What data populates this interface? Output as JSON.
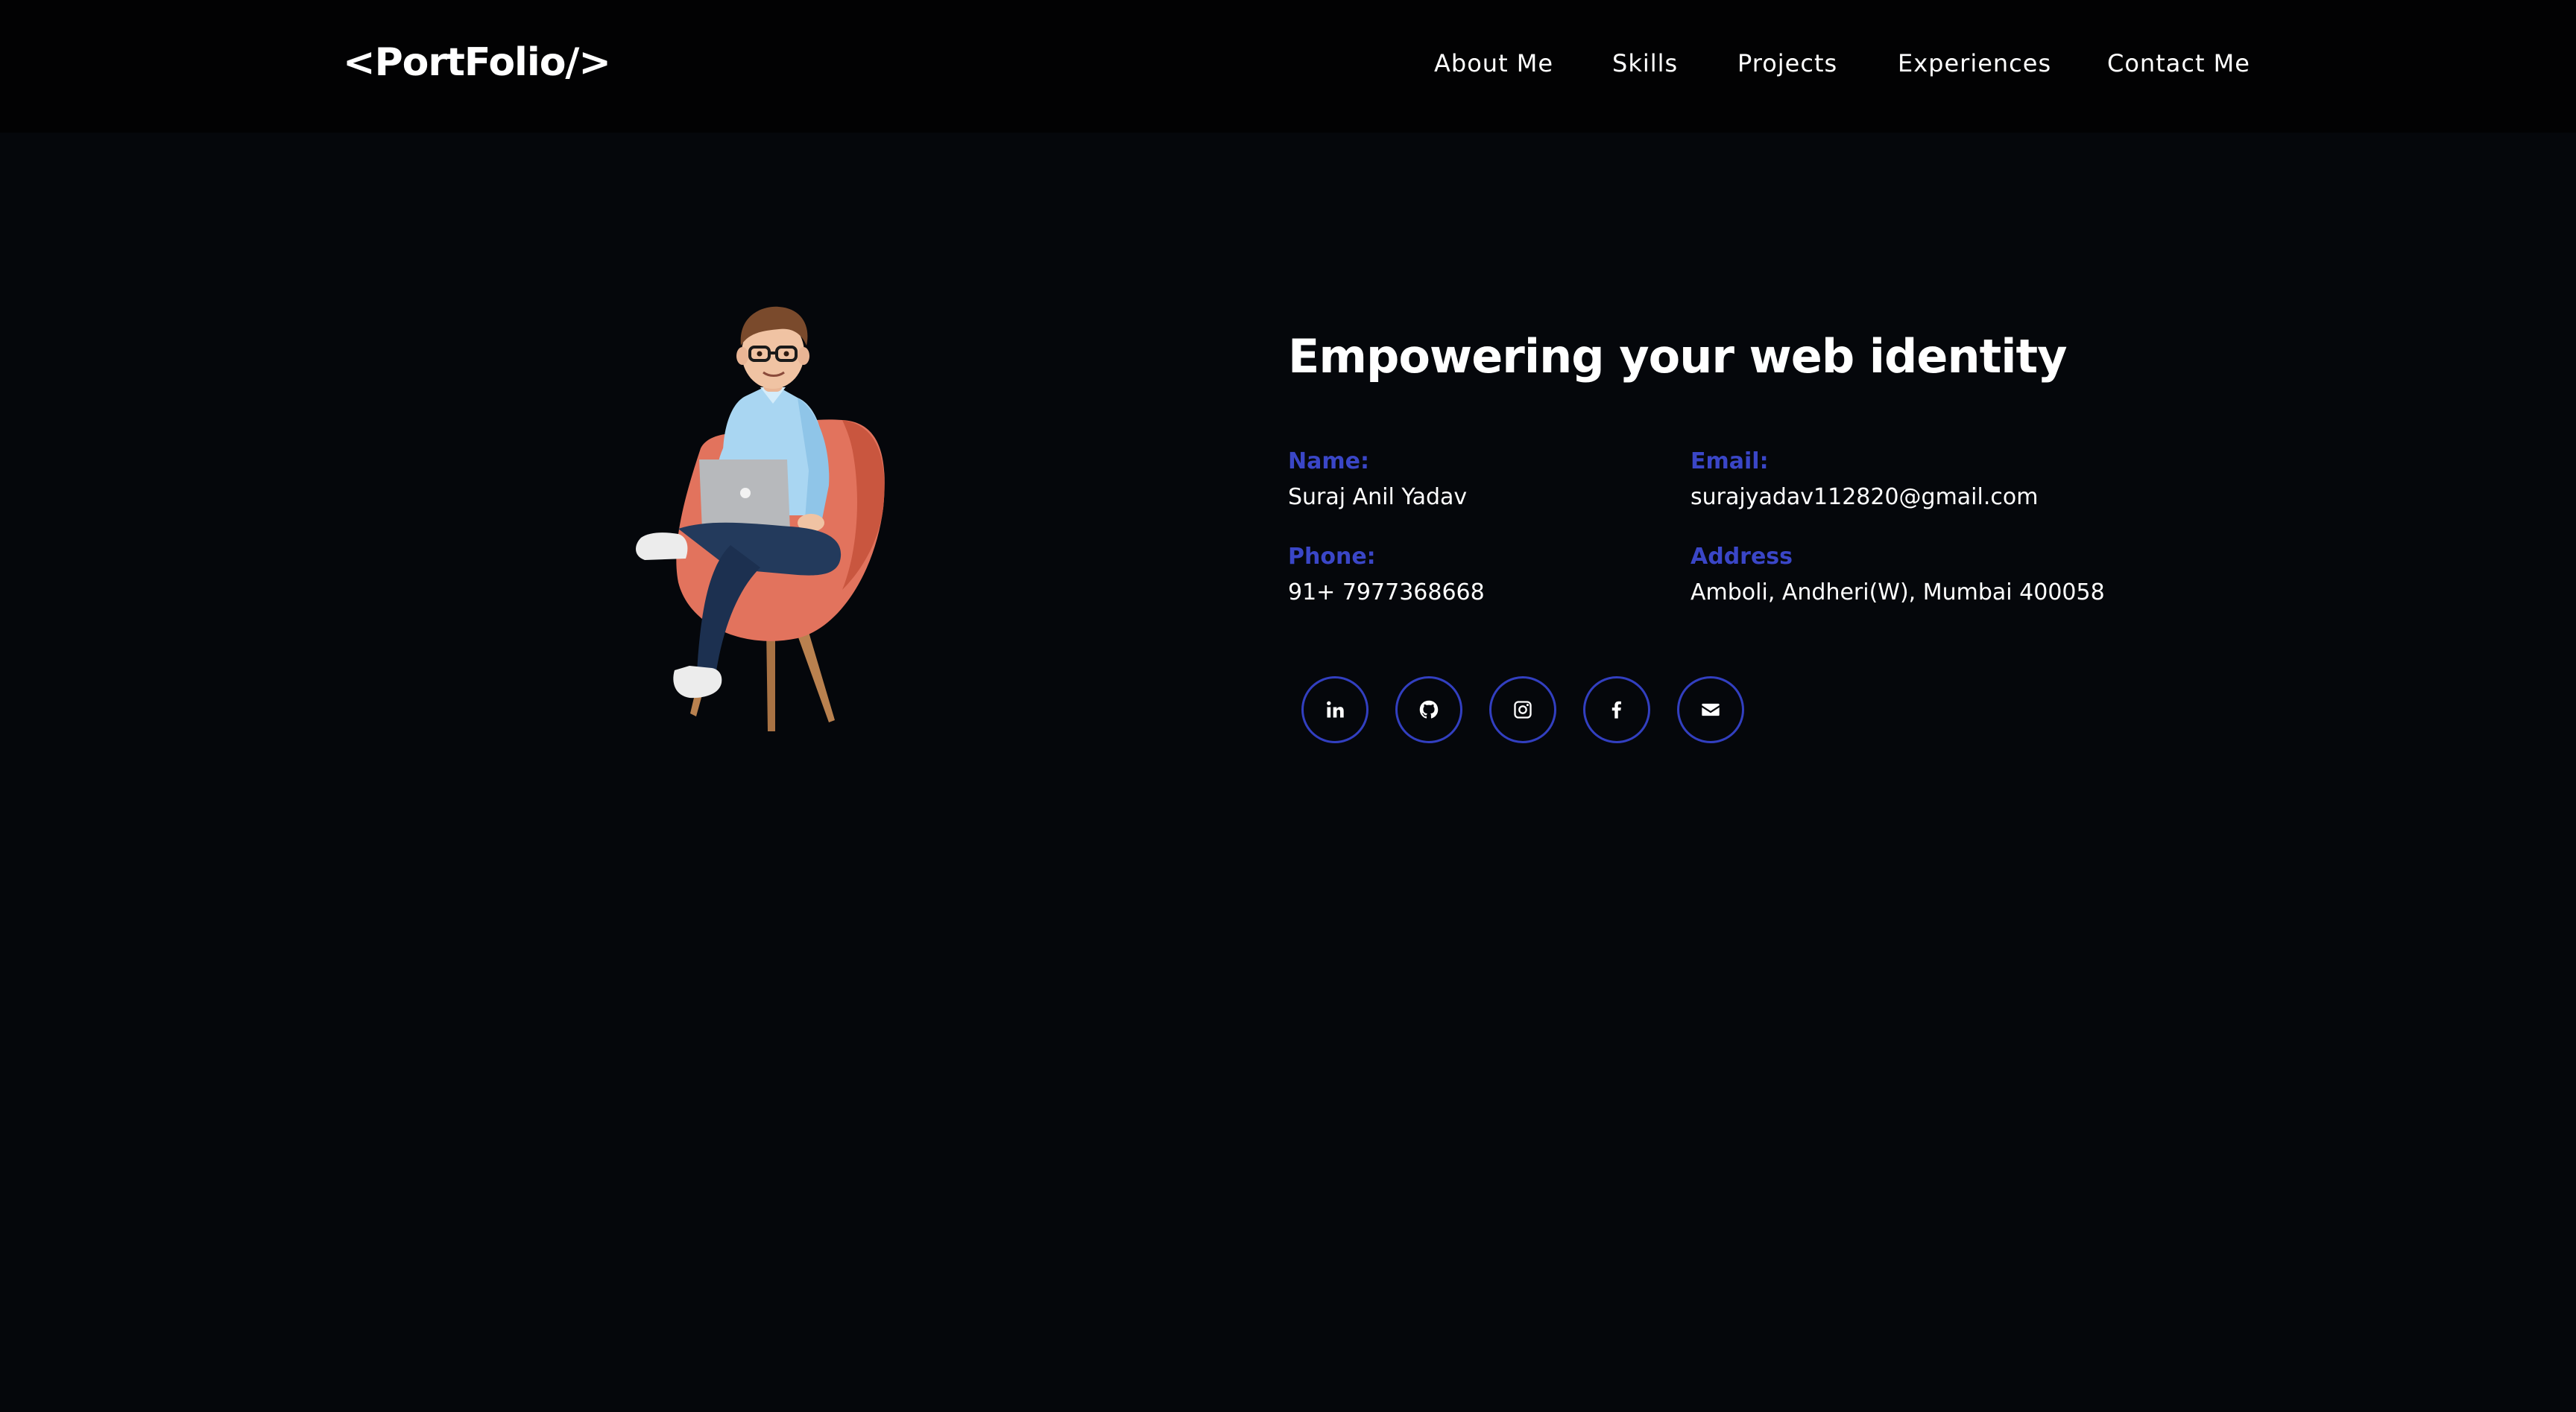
{
  "header": {
    "logo": "<PortFolio/>",
    "nav": [
      {
        "label": "About Me"
      },
      {
        "label": "Skills"
      },
      {
        "label": "Projects"
      },
      {
        "label": "Experiences"
      },
      {
        "label": "Contact Me"
      }
    ]
  },
  "contact": {
    "headline": "Empowering your web identity",
    "name_label": "Name:",
    "name_value": "Suraj Anil Yadav",
    "email_label": "Email:",
    "email_value": "surajyadav112820@gmail.com",
    "phone_label": "Phone:",
    "phone_value": "91+ 7977368668",
    "address_label": "Address",
    "address_value": "Amboli, Andheri(W), Mumbai 400058"
  },
  "social": [
    {
      "icon": "linkedin-icon"
    },
    {
      "icon": "github-icon"
    },
    {
      "icon": "instagram-icon"
    },
    {
      "icon": "facebook-icon"
    },
    {
      "icon": "mail-icon"
    }
  ],
  "colors": {
    "background": "#05070b",
    "navbar": "#020203",
    "accent": "#3a46c7",
    "text": "#ffffff",
    "chair": "#e2735d",
    "shirt": "#a9d6f2",
    "jeans": "#233a5c"
  }
}
